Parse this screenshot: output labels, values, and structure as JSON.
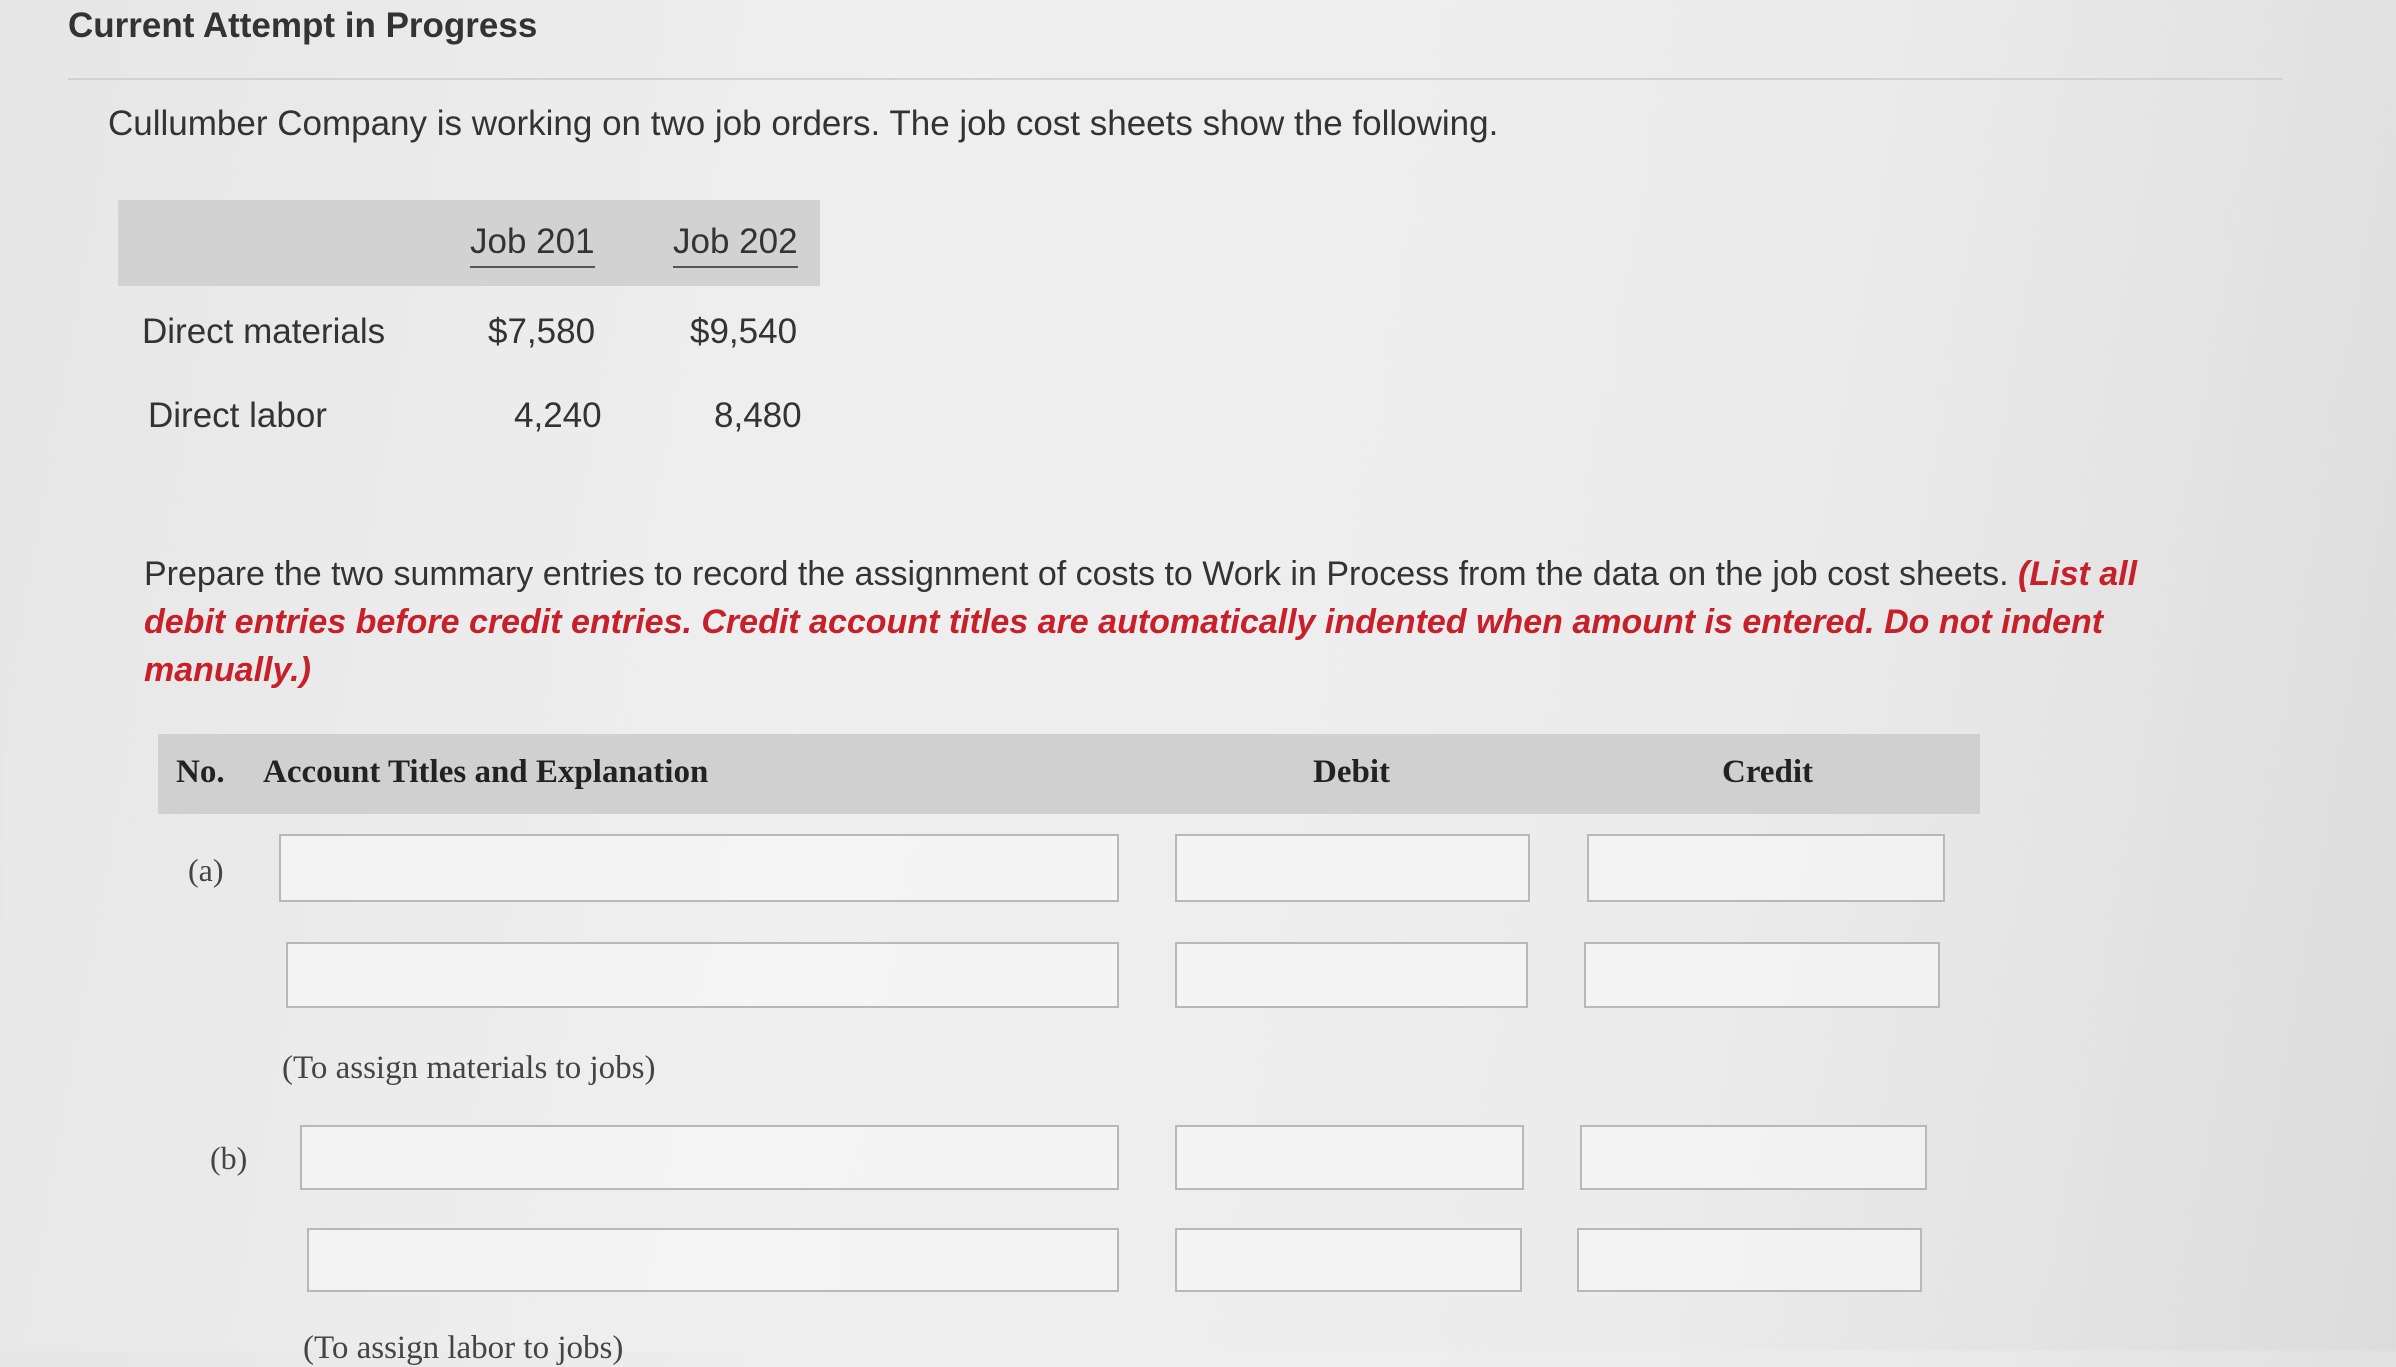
{
  "header": {
    "title": "Current Attempt in Progress"
  },
  "problem": {
    "intro": "Cullumber Company is working on two job orders. The job cost sheets show the following.",
    "job_table": {
      "columns": [
        "Job 201",
        "Job 202"
      ],
      "rows": [
        {
          "label": "Direct materials",
          "job201": "$7,580",
          "job202": "$9,540"
        },
        {
          "label": "Direct labor",
          "job201": "4,240",
          "job202": "8,480"
        }
      ]
    },
    "instructions_plain": "Prepare the two summary entries to record the assignment of costs to Work in Process from the data on the job cost sheets.",
    "instructions_red": "(List all debit entries before credit entries. Credit account titles are automatically indented when amount is entered. Do not indent manually.)"
  },
  "journal": {
    "headers": {
      "no": "No.",
      "account": "Account Titles and Explanation",
      "debit": "Debit",
      "credit": "Credit"
    },
    "entries": [
      {
        "label": "(a)",
        "memo": "(To assign materials to jobs)",
        "lines": [
          {
            "account": "",
            "debit": "",
            "credit": ""
          },
          {
            "account": "",
            "debit": "",
            "credit": ""
          }
        ]
      },
      {
        "label": "(b)",
        "memo": "(To assign labor to jobs)",
        "lines": [
          {
            "account": "",
            "debit": "",
            "credit": ""
          },
          {
            "account": "",
            "debit": "",
            "credit": ""
          }
        ]
      }
    ]
  }
}
